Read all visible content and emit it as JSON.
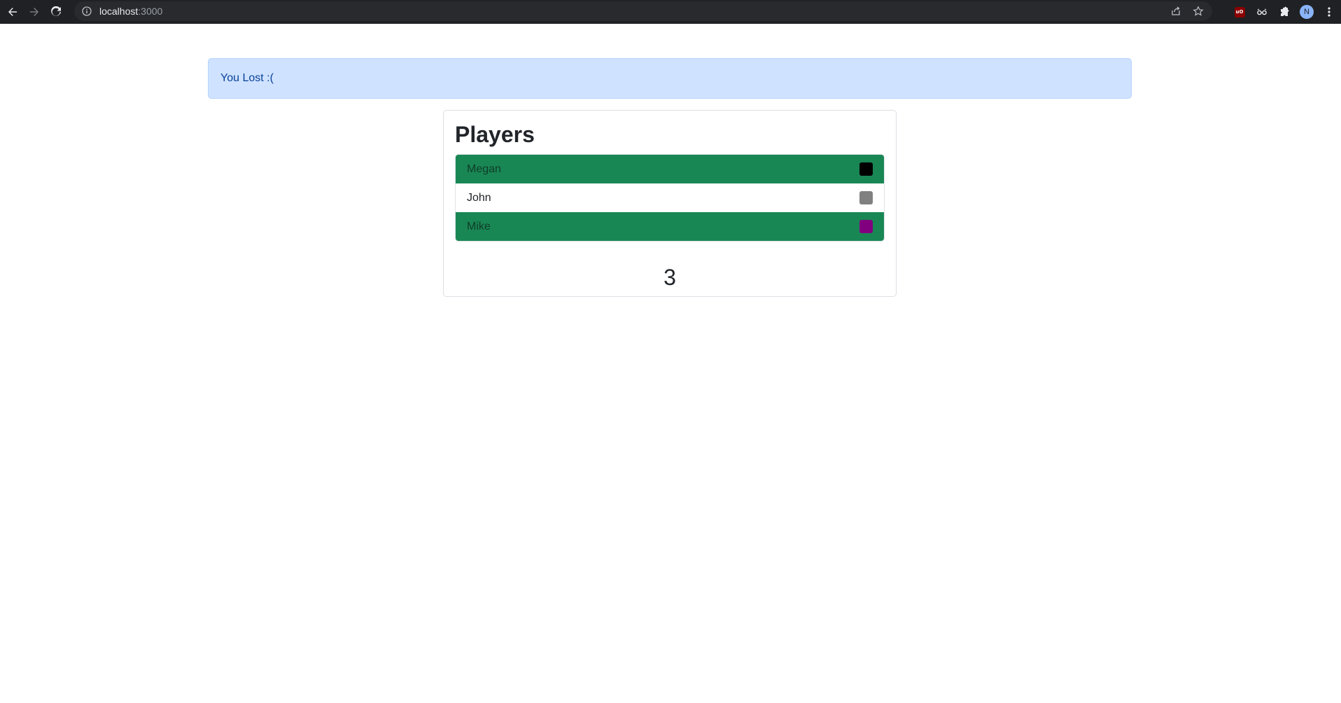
{
  "browser": {
    "url_host": "localhost",
    "url_port": ":3000"
  },
  "alert": {
    "message": "You Lost :("
  },
  "players_card": {
    "title": "Players",
    "players": [
      {
        "name": "Megan",
        "color": "#000000",
        "highlighted": true
      },
      {
        "name": "John",
        "color": "#808080",
        "highlighted": false
      },
      {
        "name": "Mike",
        "color": "#800080",
        "highlighted": true
      }
    ],
    "count": "3"
  },
  "colors": {
    "highlight": "#198754",
    "alert_bg": "#cfe2ff"
  }
}
